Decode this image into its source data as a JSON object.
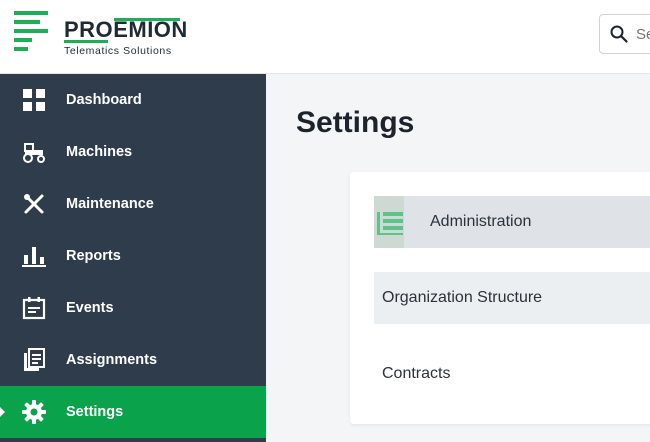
{
  "brand": {
    "name_part1": "PRO",
    "name_part2": "EMION",
    "tagline": "Telematics Solutions"
  },
  "search": {
    "placeholder": "Search",
    "icon": "search-icon"
  },
  "sidebar": {
    "items": [
      {
        "label": "Dashboard",
        "icon": "dashboard-icon"
      },
      {
        "label": "Machines",
        "icon": "tractor-icon"
      },
      {
        "label": "Maintenance",
        "icon": "tools-icon"
      },
      {
        "label": "Reports",
        "icon": "bar-chart-icon"
      },
      {
        "label": "Events",
        "icon": "calendar-icon"
      },
      {
        "label": "Assignments",
        "icon": "documents-icon"
      },
      {
        "label": "Settings",
        "icon": "gear-icon",
        "active": true
      }
    ]
  },
  "main": {
    "title": "Settings",
    "rows": [
      {
        "label": "Administration",
        "icon": "org-tree-icon"
      },
      {
        "label": "Organization Structure"
      },
      {
        "label": "Contracts"
      }
    ]
  },
  "colors": {
    "sidebar_bg": "#2f3c4b",
    "accent_green": "#0aa24a",
    "logo_green": "#1fae58"
  }
}
